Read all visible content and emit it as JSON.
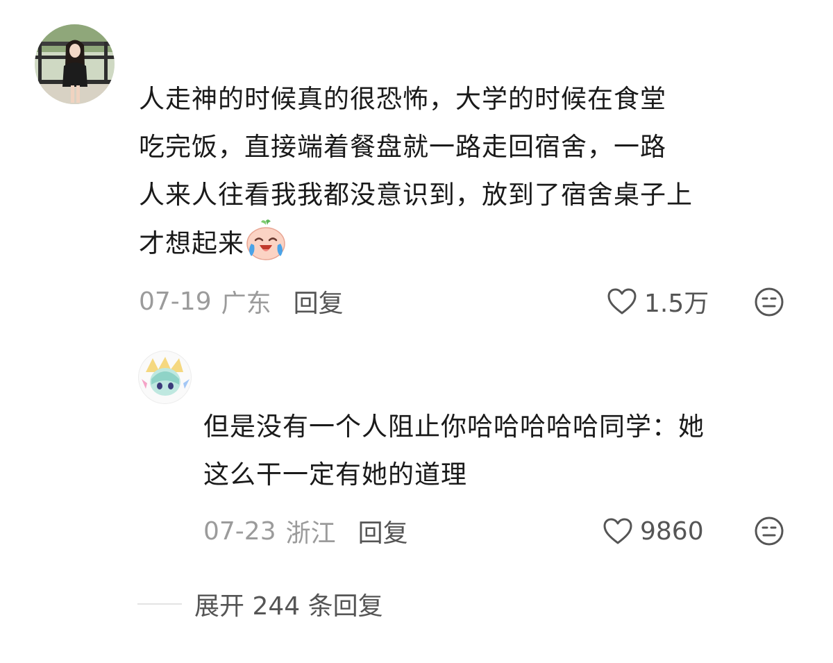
{
  "comments": [
    {
      "text": "人走神的时候真的很恐怖，大学的时候在食堂吃完饭，直接端着餐盘就一路走回宿舍，一路人来人往看我我都没意识到，放到了宿舍桌子上才想起来",
      "lines": [
        "人走神的时候真的很恐怖，大学的时候在食堂",
        "吃完饭，直接端着餐盘就一路走回宿舍，一路",
        "人来人往看我我都没意识到，放到了宿舍桌子上",
        "才想起来"
      ],
      "emoji": "crying-laughing-emoji",
      "date": "07-19",
      "location": "广东",
      "reply_label": "回复",
      "like_count": "1.5万"
    }
  ],
  "reply": {
    "lines": [
      "但是没有一个人阻止你哈哈哈哈哈同学：她",
      "这么干一定有她的道理"
    ],
    "date": "07-23",
    "location": "浙江",
    "reply_label": "回复",
    "like_count": "9860"
  },
  "expand": {
    "label": "展开 244 条回复"
  },
  "colors": {
    "text": "#1a1a1a",
    "meta": "#9b9b9b",
    "action": "#555555",
    "divider": "#e3e3e3"
  },
  "icons": [
    "heart-outline-icon",
    "dislike-face-icon",
    "crying-laughing-emoji"
  ]
}
